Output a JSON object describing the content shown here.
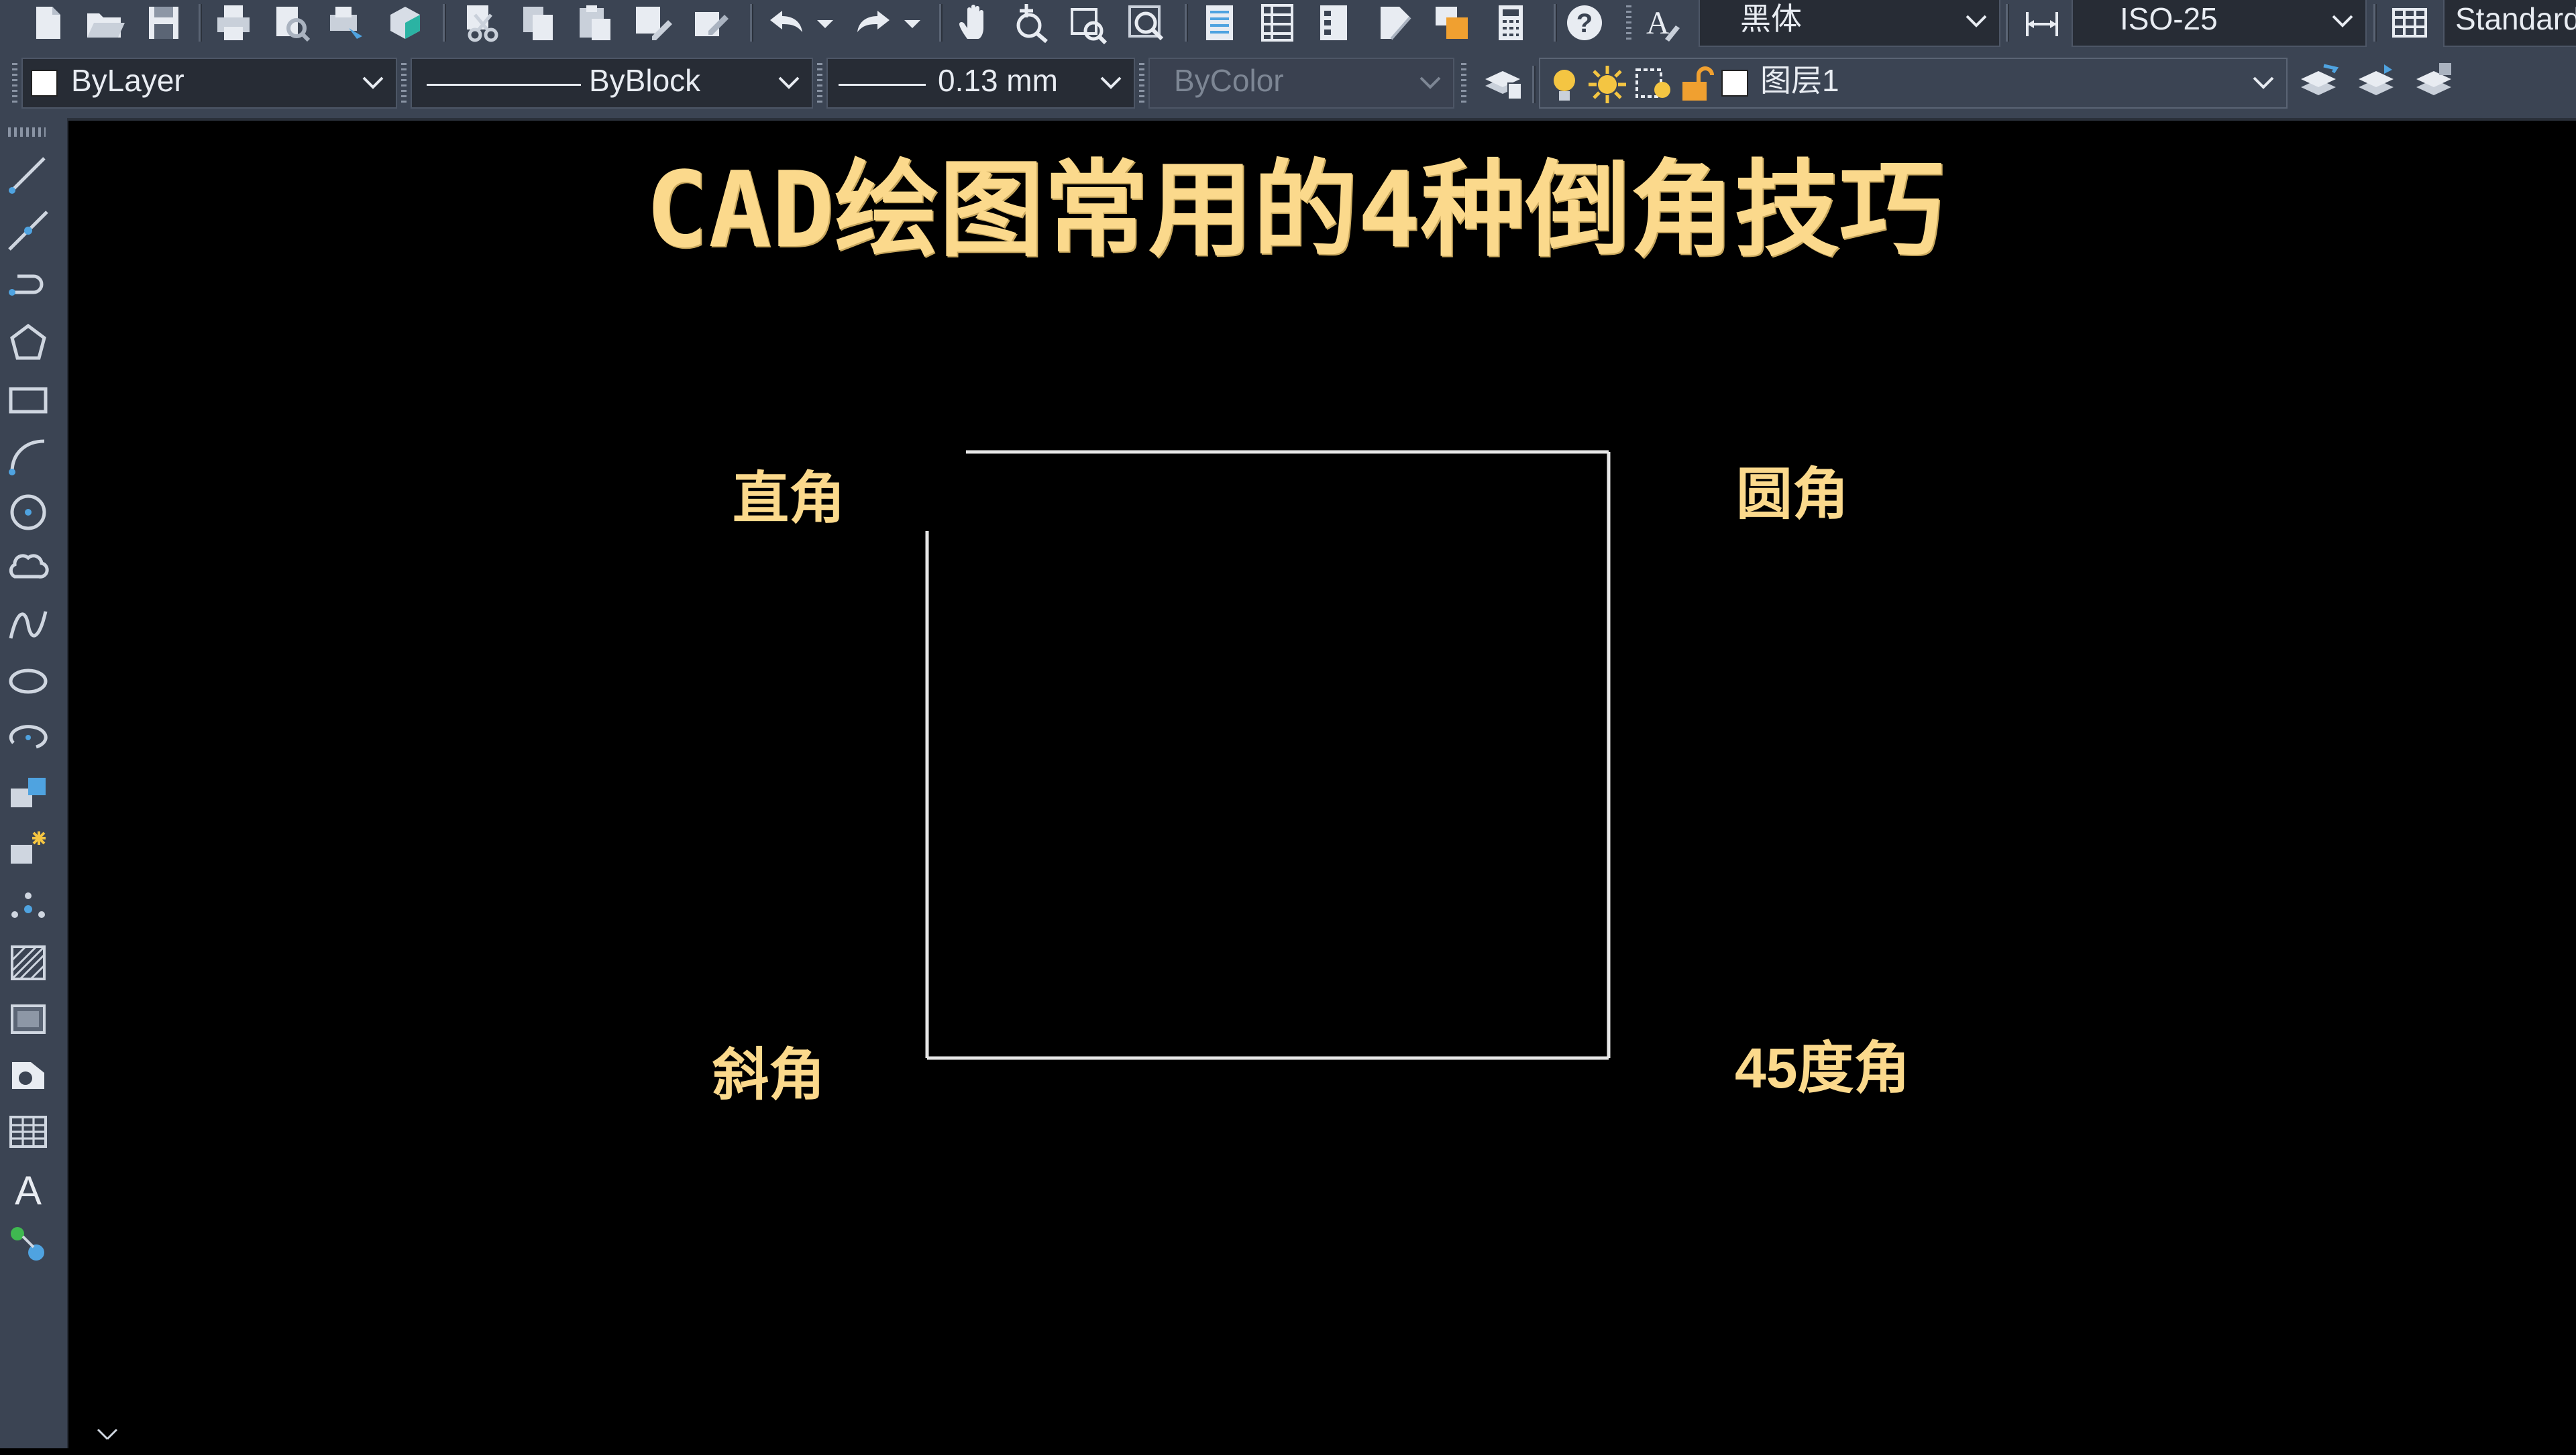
{
  "toolbar_row1": {
    "icons": [
      "new-icon",
      "open-icon",
      "save-icon",
      "print-icon",
      "print-preview-icon",
      "publish-icon",
      "3d-print-icon",
      "cut-icon",
      "copy-icon",
      "paste-icon",
      "match-properties-icon",
      "block-editor-icon",
      "undo-icon",
      "undo-dropdown-icon",
      "redo-icon",
      "redo-dropdown-icon",
      "pan-icon",
      "zoom-realtime-icon",
      "zoom-window-icon",
      "zoom-previous-icon",
      "properties-icon",
      "design-center-icon",
      "tool-palettes-icon",
      "sheet-set-icon",
      "markup-icon",
      "quickcalc-icon",
      "help-icon"
    ],
    "text_style": "黑体",
    "dim_style": "ISO-25",
    "table_style": "Standard"
  },
  "toolbar_row2": {
    "color": "ByLayer",
    "linetype": "ByBlock",
    "lineweight": "0.13 mm",
    "plot_style": "ByColor",
    "layer": "图层1"
  },
  "left_palette": {
    "icons": [
      "line-icon",
      "construction-line-icon",
      "polyline-icon",
      "polygon-icon",
      "rectangle-icon",
      "arc-icon",
      "circle-icon",
      "revision-cloud-icon",
      "spline-icon",
      "ellipse-icon",
      "ellipse-arc-icon",
      "insert-block-icon",
      "make-block-icon",
      "point-icon",
      "hatch-icon",
      "region-icon",
      "gradient-icon",
      "table-icon",
      "multiline-text-icon",
      "add-selected-icon"
    ]
  },
  "drawing": {
    "title": "CAD绘图常用的4种倒角技巧",
    "labels": {
      "top_left": "直角",
      "top_right": "圆角",
      "bottom_left": "斜角",
      "bottom_right": "45度角"
    }
  }
}
